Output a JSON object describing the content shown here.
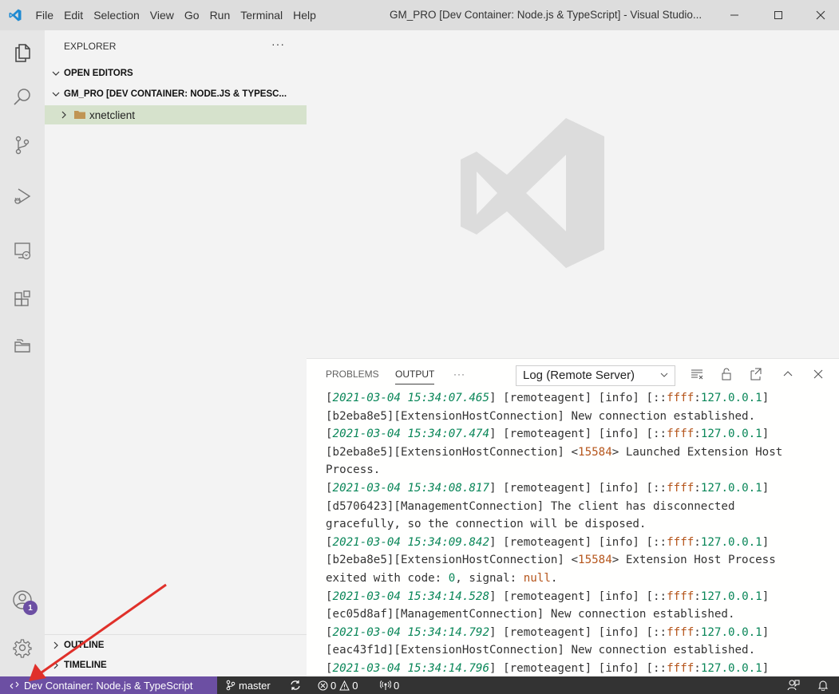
{
  "window": {
    "title": "GM_PRO [Dev Container: Node.js & TypeScript] - Visual Studio...",
    "menu": [
      "File",
      "Edit",
      "Selection",
      "View",
      "Go",
      "Run",
      "Terminal",
      "Help"
    ]
  },
  "activity": {
    "accounts_badge": "1"
  },
  "sidebar": {
    "title": "EXPLORER",
    "more": "···",
    "open_editors": "OPEN EDITORS",
    "workspace": "GM_PRO [DEV CONTAINER: NODE.JS & TYPESC...",
    "folder": "xnetclient",
    "outline": "OUTLINE",
    "timeline": "TIMELINE"
  },
  "panel": {
    "tabs": [
      "PROBLEMS",
      "OUTPUT"
    ],
    "more": "···",
    "active_tab": "OUTPUT",
    "log_source": "Log (Remote Server)"
  },
  "log_lines": [
    [
      [
        "ts",
        "2021-03-04 15:34:07.465"
      ],
      [
        "",
        "] [remoteagent] [info] [::"
      ],
      [
        "hex",
        "ffff"
      ],
      [
        "",
        ":"
      ],
      [
        "num",
        "127.0.0.1"
      ],
      [
        "",
        "]"
      ]
    ],
    [
      [
        "",
        "[b2eba8e5][ExtensionHostConnection] New connection established."
      ]
    ],
    [
      [
        "ts",
        "2021-03-04 15:34:07.474"
      ],
      [
        "",
        "] [remoteagent] [info] [::"
      ],
      [
        "hex",
        "ffff"
      ],
      [
        "",
        ":"
      ],
      [
        "num",
        "127.0.0.1"
      ],
      [
        "",
        "]"
      ]
    ],
    [
      [
        "",
        "[b2eba8e5][ExtensionHostConnection] <"
      ],
      [
        "hex",
        "15584"
      ],
      [
        "",
        "> Launched Extension Host"
      ]
    ],
    [
      [
        "",
        "Process."
      ]
    ],
    [
      [
        "ts",
        "2021-03-04 15:34:08.817"
      ],
      [
        "",
        "] [remoteagent] [info] [::"
      ],
      [
        "hex",
        "ffff"
      ],
      [
        "",
        ":"
      ],
      [
        "num",
        "127.0.0.1"
      ],
      [
        "",
        "]"
      ]
    ],
    [
      [
        "",
        "[d5706423][ManagementConnection] The client has disconnected"
      ]
    ],
    [
      [
        "",
        "gracefully, so the connection will be disposed."
      ]
    ],
    [
      [
        "ts",
        "2021-03-04 15:34:09.842"
      ],
      [
        "",
        "] [remoteagent] [info] [::"
      ],
      [
        "hex",
        "ffff"
      ],
      [
        "",
        ":"
      ],
      [
        "num",
        "127.0.0.1"
      ],
      [
        "",
        "]"
      ]
    ],
    [
      [
        "",
        "[b2eba8e5][ExtensionHostConnection] <"
      ],
      [
        "hex",
        "15584"
      ],
      [
        "",
        "> Extension Host Process"
      ]
    ],
    [
      [
        "",
        "exited with code: "
      ],
      [
        "num",
        "0"
      ],
      [
        "",
        ", signal: "
      ],
      [
        "kw",
        "null"
      ],
      [
        "",
        "."
      ]
    ],
    [
      [
        "ts",
        "2021-03-04 15:34:14.528"
      ],
      [
        "",
        "] [remoteagent] [info] [::"
      ],
      [
        "hex",
        "ffff"
      ],
      [
        "",
        ":"
      ],
      [
        "num",
        "127.0.0.1"
      ],
      [
        "",
        "]"
      ]
    ],
    [
      [
        "",
        "[ec05d8af][ManagementConnection] New connection established."
      ]
    ],
    [
      [
        "ts",
        "2021-03-04 15:34:14.792"
      ],
      [
        "",
        "] [remoteagent] [info] [::"
      ],
      [
        "hex",
        "ffff"
      ],
      [
        "",
        ":"
      ],
      [
        "num",
        "127.0.0.1"
      ],
      [
        "",
        "]"
      ]
    ],
    [
      [
        "",
        "[eac43f1d][ExtensionHostConnection] New connection established."
      ]
    ],
    [
      [
        "ts",
        "2021-03-04 15:34:14.796"
      ],
      [
        "",
        "] [remoteagent] [info] [::"
      ],
      [
        "hex",
        "ffff"
      ],
      [
        "",
        ":"
      ],
      [
        "num",
        "127.0.0.1"
      ],
      [
        "",
        "]"
      ]
    ]
  ],
  "statusbar": {
    "remote_label": "Dev Container: Node.js & TypeScript",
    "branch": "master",
    "errors": "0",
    "warnings": "0",
    "ports": "0"
  },
  "colors": {
    "remote_bg": "#6c4fa3",
    "statusbar_bg": "#333333",
    "timestamp": "#098658",
    "hex_value": "#b5551b",
    "annotation_arrow": "#e0302a"
  }
}
